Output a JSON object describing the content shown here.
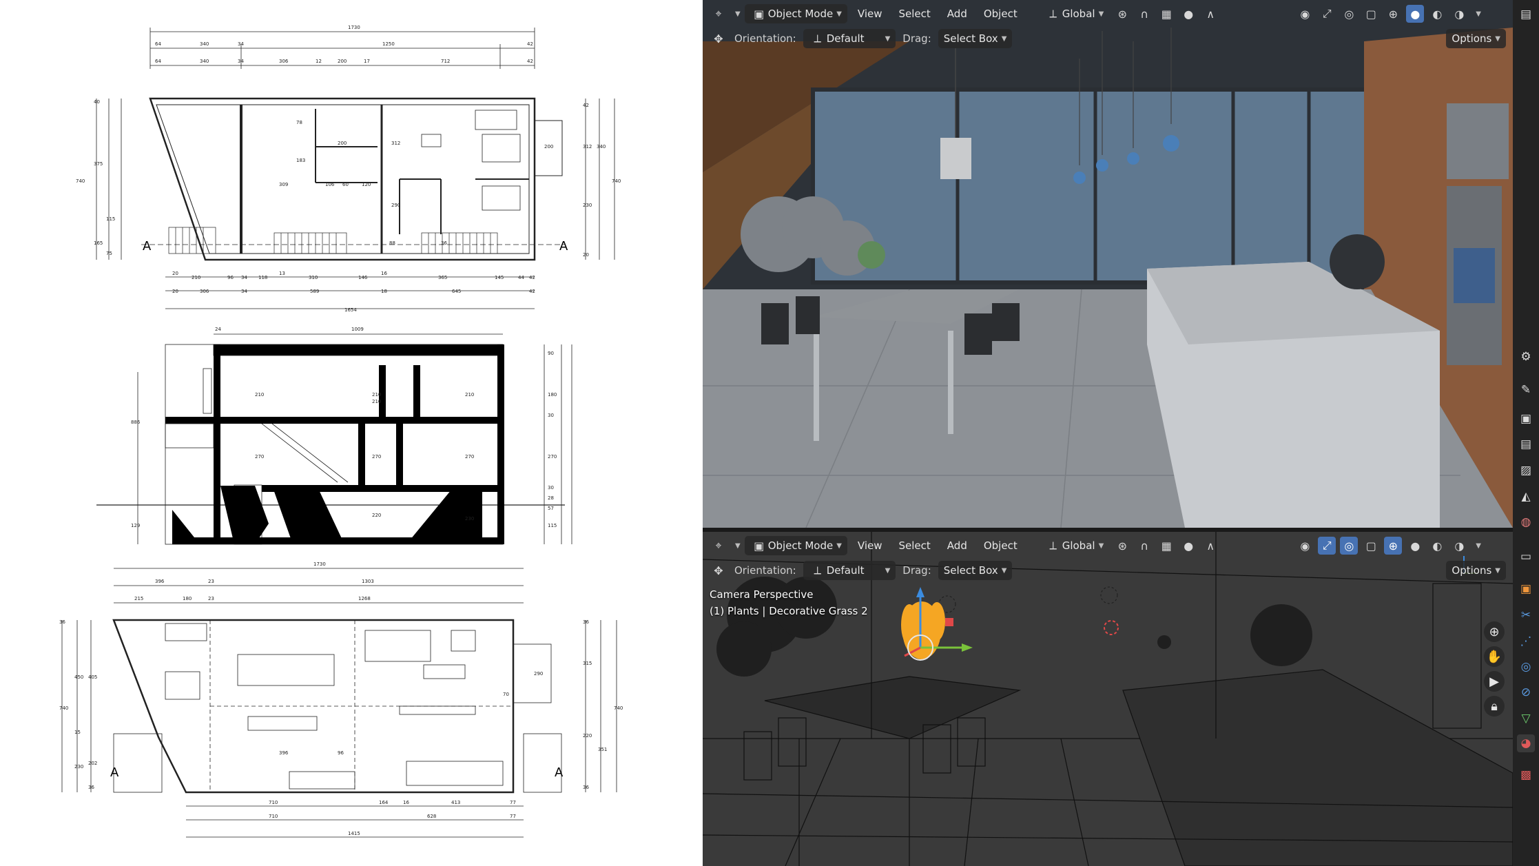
{
  "drawings": {
    "plan_top": {
      "overall_dims": [
        "1730"
      ],
      "row2_dims": [
        "64",
        "340",
        "34",
        "1250",
        "42"
      ],
      "row3_dims": [
        "64",
        "340",
        "34",
        "306",
        "12",
        "200",
        "17",
        "712",
        "42"
      ],
      "bottom_dims_row1": [
        "20",
        "210",
        "96",
        "34",
        "118",
        "13",
        "310",
        "146",
        "16",
        "365",
        "145",
        "44",
        "42"
      ],
      "bottom_dims_row2": [
        "20",
        "306",
        "34",
        "589",
        "18",
        "645",
        "42"
      ],
      "bottom_total": "1654",
      "left_dims": [
        "40",
        "375",
        "740",
        "115",
        "165",
        "75"
      ],
      "right_dims": [
        "42",
        "312",
        "340",
        "230",
        "740",
        "20"
      ],
      "interior_dims": [
        "78",
        "183",
        "200",
        "309",
        "106",
        "60",
        "120",
        "312",
        "290",
        "200",
        "88",
        "36"
      ],
      "section_marker": "A"
    },
    "section": {
      "top_dims": [
        "24",
        "1009"
      ],
      "left_dims": [
        "886",
        "129"
      ],
      "interior_dims": [
        "210",
        "210",
        "210",
        "210",
        "270",
        "270",
        "270",
        "220",
        "230"
      ],
      "right_dims": [
        "90",
        "180",
        "30",
        "270",
        "30",
        "28",
        "57",
        "115"
      ]
    },
    "plan_bottom": {
      "overall_dims": [
        "1730"
      ],
      "row2_dims": [
        "396",
        "23",
        "1303"
      ],
      "row3_dims": [
        "215",
        "180",
        "23",
        "1268"
      ],
      "left_dims": [
        "36",
        "450",
        "740",
        "405",
        "15",
        "230",
        "202",
        "36"
      ],
      "right_dims": [
        "36",
        "315",
        "740",
        "220",
        "351",
        "36"
      ],
      "interior_dims": [
        "290",
        "70",
        "396",
        "96"
      ],
      "bottom_dims_row1": [
        "710",
        "164",
        "16",
        "413",
        "77"
      ],
      "bottom_dims_row2": [
        "710",
        "628",
        "77"
      ],
      "bottom_total": "1415",
      "section_marker": "A"
    }
  },
  "blender": {
    "header": {
      "mode": "Object Mode",
      "menus": [
        "View",
        "Select",
        "Add",
        "Object"
      ],
      "transform": "Global",
      "orientation_label": "Orientation:",
      "orientation_value": "Default",
      "drag_label": "Drag:",
      "drag_value": "Select Box",
      "options_label": "Options"
    },
    "viewport_bottom": {
      "overlay_line1": "Camera Perspective",
      "overlay_line2": "(1) Plants | Decorative Grass 2"
    },
    "colors": {
      "accent": "#4772b3",
      "gizmo_x": "#e04848",
      "gizmo_y": "#7ac23a",
      "gizmo_z": "#3b8ce0",
      "selection": "#f5a623"
    },
    "icons": {
      "toolstrip": [
        "view-icon",
        "tool-icon",
        "render-icon",
        "output-icon",
        "image-icon",
        "scene-icon",
        "world-icon",
        "collection-icon",
        "object-icon",
        "modifier-icon",
        "particles-icon",
        "physics-icon",
        "constraints-icon",
        "data-icon",
        "material-icon",
        "texture-icon"
      ]
    }
  }
}
